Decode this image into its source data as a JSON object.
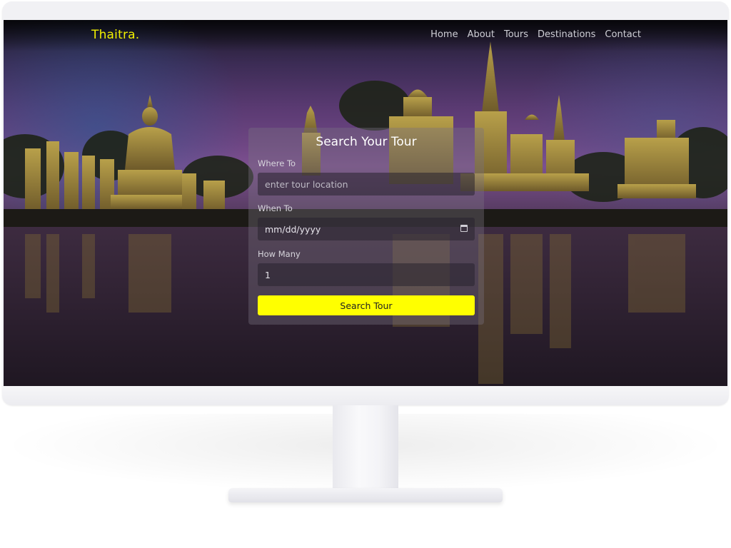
{
  "header": {
    "logo": "Thaitra.",
    "nav": [
      "Home",
      "About",
      "Tours",
      "Destinations",
      "Contact"
    ]
  },
  "search": {
    "title": "Search Your Tour",
    "where": {
      "label": "Where To",
      "placeholder": "enter tour location"
    },
    "when": {
      "label": "When To",
      "placeholder": "mm/dd/yyyy"
    },
    "how_many": {
      "label": "How Many",
      "value": "1"
    },
    "button_label": "Search Tour"
  },
  "colors": {
    "accent": "#ffff00",
    "logo": "#f2f000"
  }
}
